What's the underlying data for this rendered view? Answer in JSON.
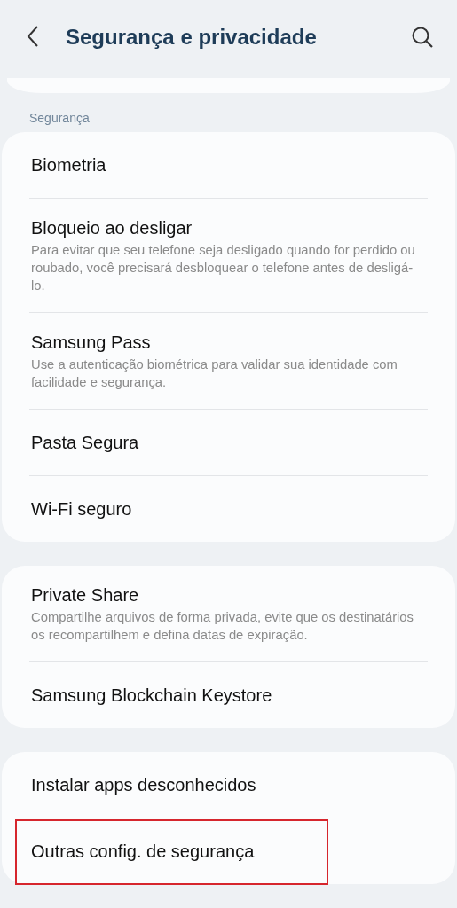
{
  "header": {
    "title": "Segurança e privacidade"
  },
  "section_label": "Segurança",
  "groups": [
    {
      "items": [
        {
          "title": "Biometria",
          "highlighted": false
        },
        {
          "title": "Bloqueio ao desligar",
          "summary": "Para evitar que seu telefone seja desligado quando for perdido ou roubado, você precisará desbloquear o telefone antes de desligá-lo.",
          "highlighted": false
        },
        {
          "title": "Samsung Pass",
          "summary": "Use a autenticação biométrica para validar sua identidade com facilidade e segurança.",
          "highlighted": false
        },
        {
          "title": "Pasta Segura",
          "highlighted": false
        },
        {
          "title": "Wi-Fi seguro",
          "highlighted": false
        }
      ]
    },
    {
      "items": [
        {
          "title": "Private Share",
          "summary": "Compartilhe arquivos de forma privada, evite que os destinatários os recompartilhem e defina datas de expiração.",
          "highlighted": false
        },
        {
          "title": "Samsung Blockchain Keystore",
          "highlighted": false
        }
      ]
    },
    {
      "items": [
        {
          "title": "Instalar apps desconhecidos",
          "highlighted": false
        },
        {
          "title": "Outras config. de segurança",
          "highlighted": true
        }
      ]
    }
  ]
}
